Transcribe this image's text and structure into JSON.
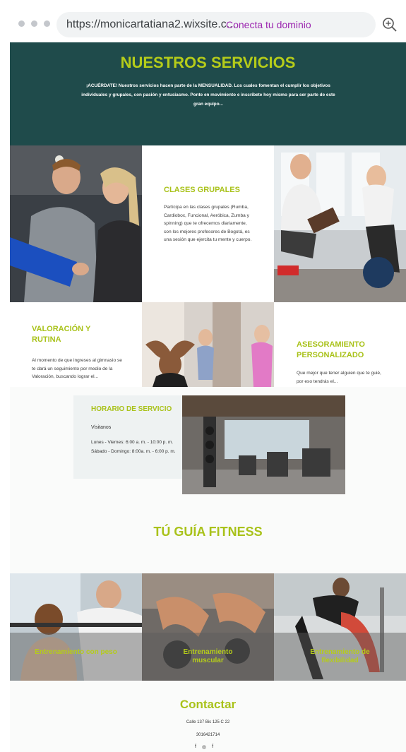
{
  "browser": {
    "url": "https://monicartatiana2.wixsite.c...",
    "domain_link": "Conecta tu dominio",
    "zoom_icon": "zoom-in-icon"
  },
  "hero": {
    "title": "NUESTROS SERVICIOS",
    "text": "¡ACUÉRDATE! Nuestros servicios hacen parte de la MENSUALIDAD. Los cuales fomentan el cumplir los objetivos individuales y grupales, con pasión y entusiasmo. Ponte en movimiento e inscríbete hoy mismo para ser parte de este gran equipo..."
  },
  "services": {
    "grupales": {
      "title": "CLASES GRUPALES",
      "text": "Participa en las clases grupales (Rumba, Cardiobox, Funcional, Aeróbica, Zumba y spinning) que te ofrecemos diariamente, con los mejores profesores de Bogotá, es una sesión que ejercita tu mente y cuerpo."
    },
    "valoracion": {
      "title": "VALORACIÓN Y RUTINA",
      "text": "Al momento de que ingreses al gimnasio se te dará un seguimiento por medio de la Valoración, buscando lograr el..."
    },
    "asesoramiento": {
      "title": "ASESORAMIENTO PERSONALIZADO",
      "text": "Que mejor que tener alguien que te guié, por eso tendrás el..."
    }
  },
  "horario": {
    "title": "HORARIO DE SERVICIO",
    "subtitle": "Visitanos",
    "line1": "Lunes - Viernes: 6:00 a. m. - 10:00 p. m.",
    "line2": "Sábado - Domingo: 8:00a. m. - 6:00 p. m."
  },
  "fitness": {
    "title": "TÚ GUÍA FITNESS",
    "cards": [
      {
        "label": "Entrenamiento con peso"
      },
      {
        "label": "Entrenamiento muscular"
      },
      {
        "label": "Entrenamiento de flexibilidad"
      }
    ]
  },
  "contact": {
    "title": "Contactar",
    "address": "Calle 137 Bis 125 C 22",
    "phone": "3016421714",
    "social_icons": [
      "facebook-icon",
      "instagram-icon",
      "facebook-icon"
    ]
  },
  "colors": {
    "accent": "#a9c21a",
    "hero_bg": "#1f4b4b"
  }
}
